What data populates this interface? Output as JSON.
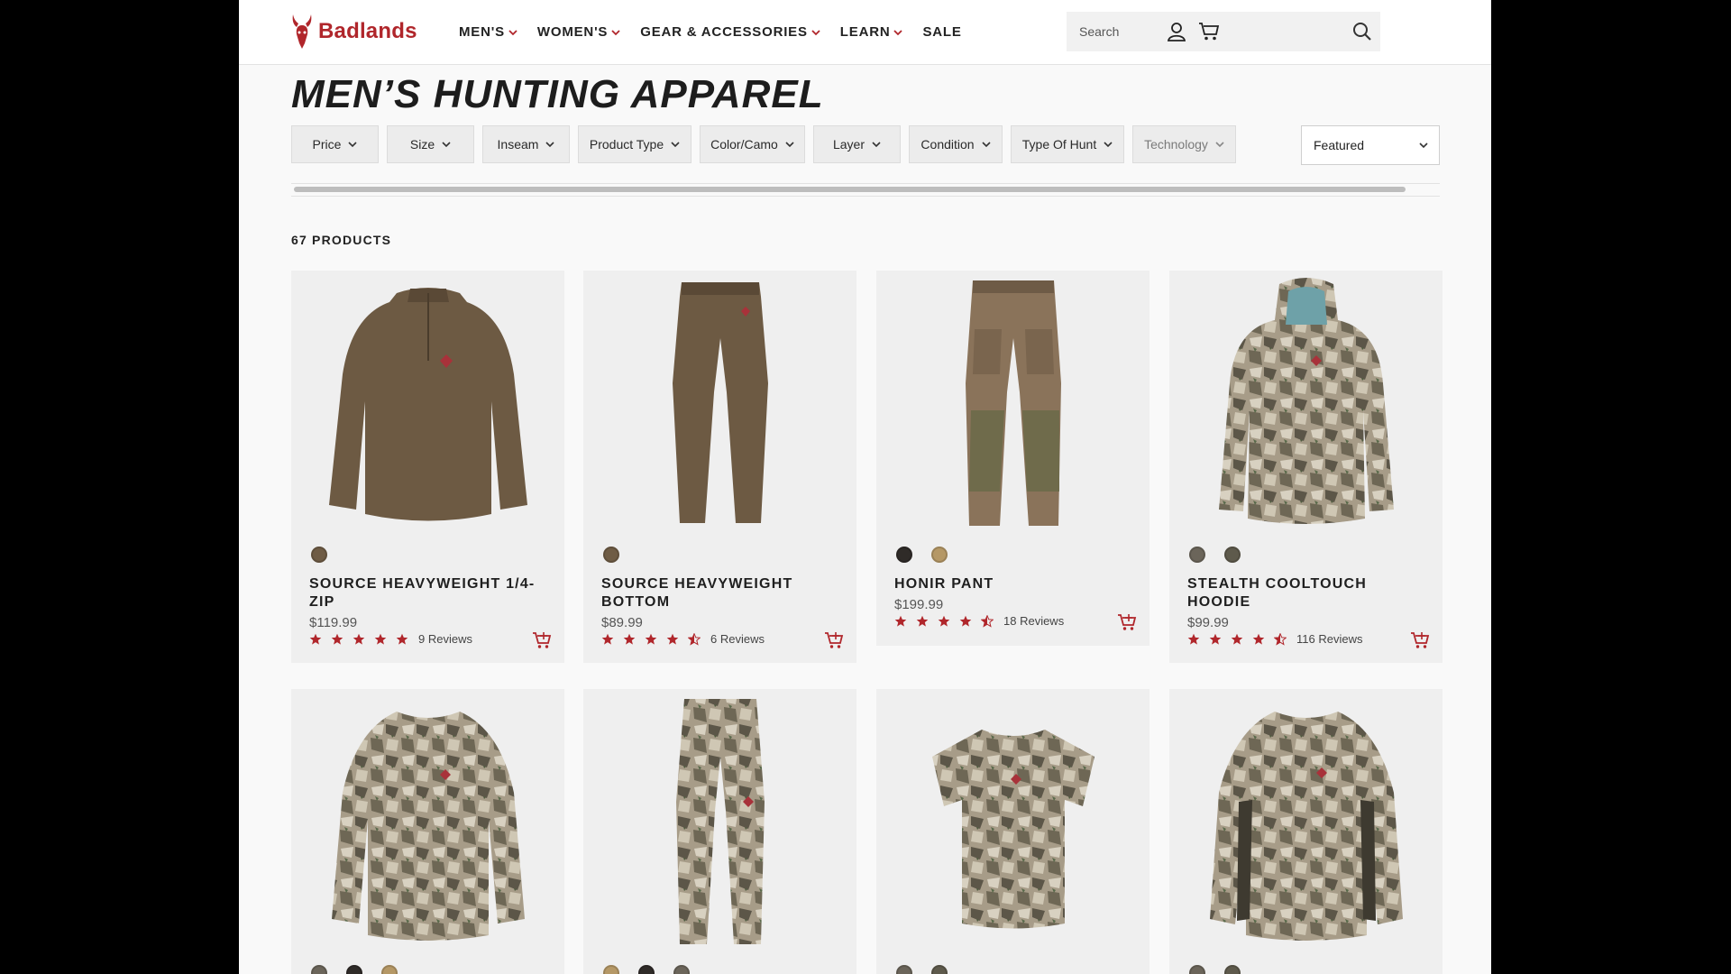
{
  "brand": {
    "name": "Badlands",
    "accent": "#b0262b"
  },
  "nav": [
    {
      "label": "MEN'S"
    },
    {
      "label": "WOMEN'S"
    },
    {
      "label": "GEAR & ACCESSORIES"
    },
    {
      "label": "LEARN"
    },
    {
      "label": "SALE"
    }
  ],
  "search": {
    "placeholder": "Search"
  },
  "header_icons": [
    "search-icon",
    "account-icon",
    "cart-icon"
  ],
  "page": {
    "title": "MEN’S HUNTING APPAREL",
    "product_count": "67 PRODUCTS"
  },
  "filters": [
    {
      "label": "Price"
    },
    {
      "label": "Size"
    },
    {
      "label": "Inseam"
    },
    {
      "label": "Product Type"
    },
    {
      "label": "Color/Camo"
    },
    {
      "label": "Layer"
    },
    {
      "label": "Condition"
    },
    {
      "label": "Type Of Hunt"
    },
    {
      "label": "Technology"
    }
  ],
  "sort": {
    "selected": "Featured"
  },
  "products": [
    {
      "name": "SOURCE HEAVYWEIGHT 1/4-ZIP",
      "price": "$119.99",
      "rating": 5,
      "reviews": "9 Reviews",
      "swatches": [
        "#6f5c45"
      ],
      "image": "quarter-zip"
    },
    {
      "name": "SOURCE HEAVYWEIGHT BOTTOM",
      "price": "$89.99",
      "rating": 4.5,
      "reviews": "6 Reviews",
      "swatches": [
        "#6f5c45"
      ],
      "image": "leggings"
    },
    {
      "name": "HONIR PANT",
      "price": "$199.99",
      "rating": 4.5,
      "reviews": "18 Reviews",
      "swatches": [
        "#2f2b28",
        "#b59866"
      ],
      "image": "pant"
    },
    {
      "name": "STEALTH COOLTOUCH HOODIE",
      "price": "$99.99",
      "rating": 4.5,
      "reviews": "116 Reviews",
      "swatches": [
        "#6b655a",
        "#5e5a4c"
      ],
      "image": "camo-hoodie"
    },
    {
      "name": "",
      "price": "",
      "rating": null,
      "reviews": "",
      "swatches": [
        "#6b655a",
        "#2f2b28",
        "#b59866"
      ],
      "image": "camo-crew"
    },
    {
      "name": "",
      "price": "",
      "rating": null,
      "reviews": "",
      "swatches": [
        "#b59866",
        "#2f2b28",
        "#6b655a"
      ],
      "image": "camo-pant"
    },
    {
      "name": "",
      "price": "",
      "rating": null,
      "reviews": "",
      "swatches": [
        "#6b655a",
        "#5e5a4c"
      ],
      "image": "camo-tee"
    },
    {
      "name": "",
      "price": "",
      "rating": null,
      "reviews": "",
      "swatches": [
        "#6b655a",
        "#5e5a4c"
      ],
      "image": "camo-longsleeve"
    }
  ]
}
